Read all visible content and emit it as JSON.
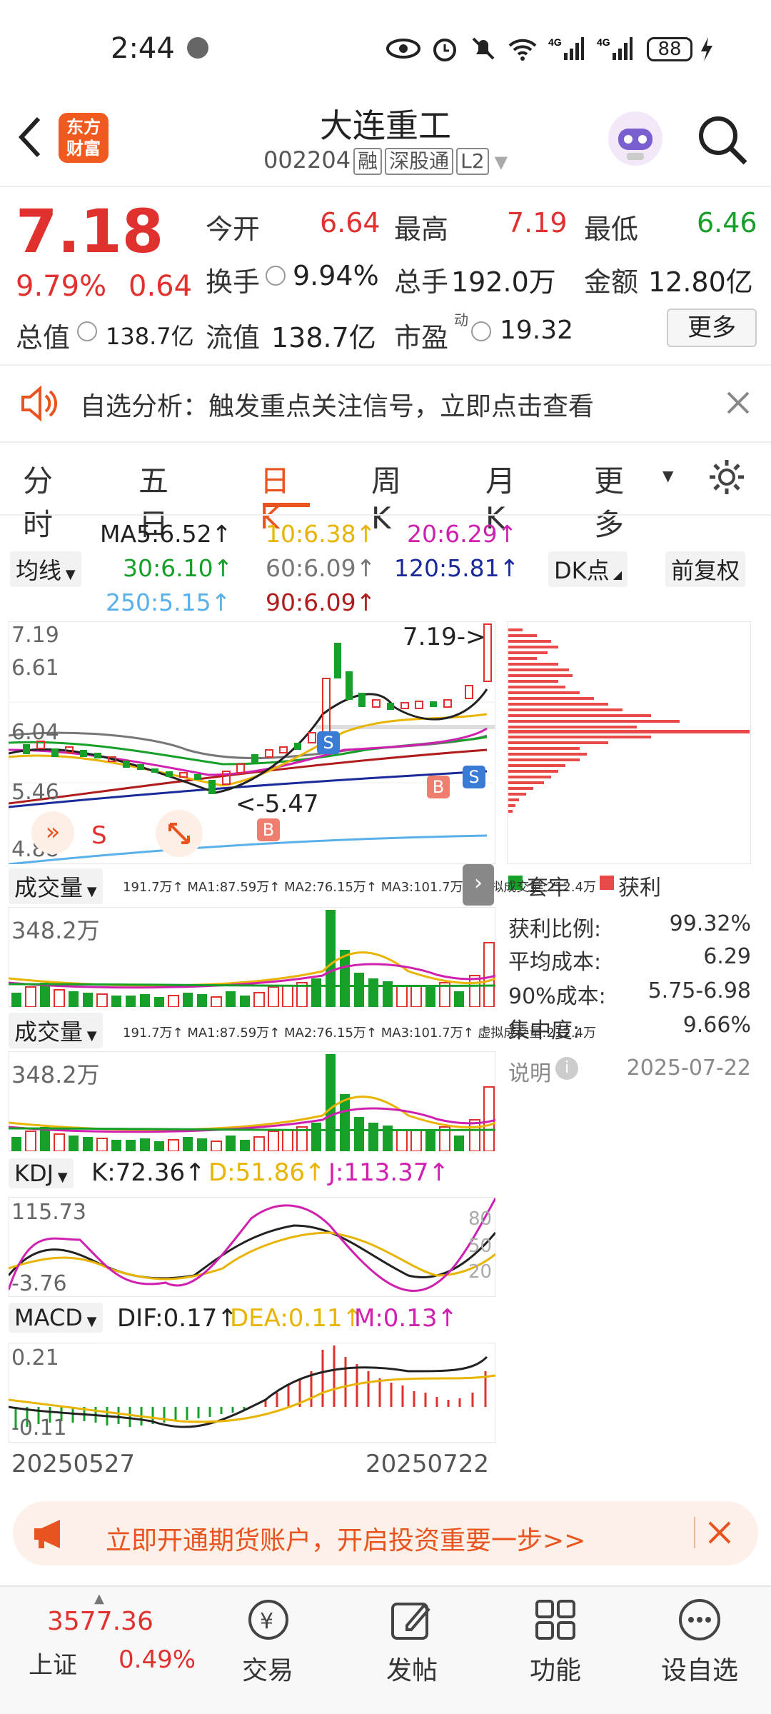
{
  "status_bar": {
    "time": "2:44",
    "battery": "88"
  },
  "header": {
    "title": "大连重工",
    "code": "002204",
    "tags": [
      "融",
      "深股通",
      "L2"
    ],
    "brand": [
      "东方",
      "财富"
    ]
  },
  "quote": {
    "price": "7.18",
    "change_pct": "9.79%",
    "change_amt": "0.64",
    "open_label": "今开",
    "open": "6.64",
    "high_label": "最高",
    "high": "7.19",
    "low_label": "最低",
    "low": "6.46",
    "turnover_label": "换手",
    "turnover": "9.94%",
    "volume_label": "总手",
    "volume": "192.0万",
    "amount_label": "金额",
    "amount": "12.80亿",
    "mktcap_label": "总值",
    "mktcap": "138.7亿",
    "float_label": "流值",
    "float": "138.7亿",
    "pe_label": "市盈",
    "pe_sup": "动",
    "pe": "19.32",
    "more_label": "更多"
  },
  "banner": {
    "text": "自选分析：触发重点关注信号，立即点击查看"
  },
  "tabs": [
    "分时",
    "五日",
    "日K",
    "周K",
    "月K",
    "更多"
  ],
  "active_tab": "日K",
  "ma": {
    "selector": "均线",
    "ma5": "MA5:6.52↑",
    "ma10": "10:6.38↑",
    "ma20": "20:6.29↑",
    "ma30": "30:6.10↑",
    "ma60": "60:6.09↑",
    "ma120": "120:5.81↑",
    "ma250": "250:5.15↑",
    "ma90": "90:6.09↑",
    "dk_label": "DK点",
    "fq_label": "前复权"
  },
  "kline": {
    "y_top": "7.19",
    "y2": "6.61",
    "y3": "6.04",
    "y4": "5.46",
    "y_bot": "4.88",
    "max_annot": "7.19->",
    "min_annot": "<-5.47",
    "markers": {
      "s": "S",
      "b": "B"
    }
  },
  "volume_panel": {
    "selector": "成交量",
    "legend": "191.7万↑ MA1:87.59万↑ MA2:76.15万↑ MA3:101.7万↑ 虚拟成交量:212.4万",
    "max": "348.2万"
  },
  "kdj": {
    "selector": "KDJ",
    "k": "K:72.36↑",
    "d": "D:51.86↑",
    "j": "J:113.37↑",
    "top": "115.73",
    "bottom": "-3.76",
    "levels": [
      "80",
      "50",
      "20"
    ]
  },
  "macd": {
    "selector": "MACD",
    "dif": "DIF:0.17↑",
    "dea": "DEA:0.11↑",
    "m": "M:0.13↑",
    "top": "0.21",
    "bottom": "-0.11"
  },
  "dates": {
    "start": "20250527",
    "end": "20250722"
  },
  "chip": {
    "legend_trapped": "套牢",
    "legend_profit": "获利",
    "rows": [
      {
        "label": "获利比例:",
        "value": "99.32%"
      },
      {
        "label": "平均成本:",
        "value": "6.29"
      },
      {
        "label": "90%成本:",
        "value": "5.75-6.98"
      },
      {
        "label": "集中度:",
        "value": "9.66%"
      }
    ],
    "note_label": "说明",
    "date": "2025-07-22"
  },
  "ad": {
    "text": "立即开通期货账户，开启投资重要一步>>"
  },
  "bottom_nav": {
    "index_value": "3577.36",
    "index_name": "上证",
    "index_change": "0.49%",
    "items": [
      "交易",
      "发帖",
      "功能",
      "设自选"
    ]
  },
  "colors": {
    "up": "#e0312e",
    "down": "#16a02a",
    "accent": "#e8531f",
    "ma5": "#222222",
    "ma10": "#e8b400",
    "ma20": "#d020b0",
    "ma30": "#16a02a",
    "ma60": "#777777",
    "ma120": "#1a2a9a",
    "ma250": "#5ab0e8",
    "ma90": "#b01c1c"
  }
}
